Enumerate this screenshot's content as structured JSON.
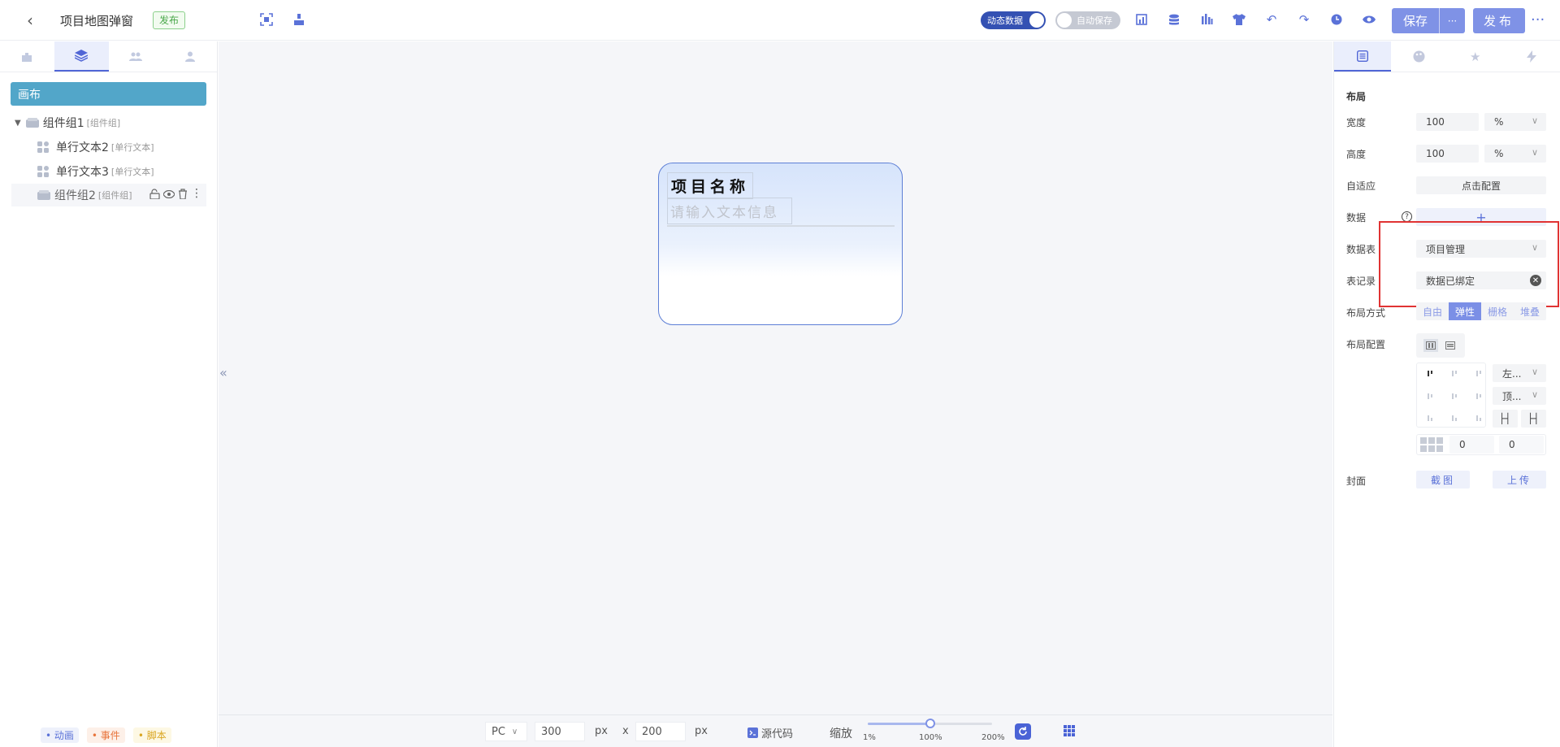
{
  "header": {
    "title": "项目地图弹窗",
    "badge": "发布",
    "dynamic_data_label": "动态数据",
    "autosave_label": "自动保存",
    "save_label": "保存",
    "save_more": "···",
    "publish_label": "发布",
    "more": "···"
  },
  "left_panel": {
    "canvas_label": "画布",
    "tree": [
      {
        "label": "组件组1",
        "type": "[组件组]"
      },
      {
        "label": "单行文本2",
        "type": "[单行文本]"
      },
      {
        "label": "单行文本3",
        "type": "[单行文本]"
      },
      {
        "label": "组件组2",
        "type": "[组件组]"
      }
    ],
    "bottom_tags": [
      {
        "label": "• 动画",
        "color": "#5b72d8",
        "bg": "#eef1fb"
      },
      {
        "label": "• 事件",
        "color": "#e8743b",
        "bg": "#fdf0e8"
      },
      {
        "label": "• 脚本",
        "color": "#d9a520",
        "bg": "#fdf8e4"
      }
    ]
  },
  "widget": {
    "title": "项目名称",
    "placeholder": "请输入文本信息"
  },
  "statusbar": {
    "device": "PC",
    "width": "300",
    "height": "200",
    "unit": "px",
    "times": "x",
    "source_code": "源代码",
    "zoom_label": "缩放",
    "zoom_min": "1%",
    "zoom_mid": "100%",
    "zoom_max": "200%",
    "zoom_value": 0.5
  },
  "props": {
    "section": "布局",
    "width_label": "宽度",
    "width_value": "100",
    "width_unit": "%",
    "height_label": "高度",
    "height_value": "100",
    "height_unit": "%",
    "adapt_label": "自适应",
    "adapt_button": "点击配置",
    "data_label": "数据",
    "data_add": "+",
    "table_label": "数据表",
    "table_value": "项目管理",
    "record_label": "表记录",
    "record_value": "数据已绑定",
    "layout_mode_label": "布局方式",
    "layout_modes": [
      "自由",
      "弹性",
      "栅格",
      "堆叠"
    ],
    "layout_mode_active": 1,
    "layout_config_label": "布局配置",
    "align_h": "左...",
    "align_v": "顶...",
    "gap_a": "0",
    "gap_b": "0",
    "cover_label": "封面",
    "screenshot_btn": "截图",
    "upload_btn": "上传"
  },
  "colors": {
    "accent": "#5b72d8",
    "canvas_item": "#52a6c9",
    "highlight_box": "#e03333"
  }
}
